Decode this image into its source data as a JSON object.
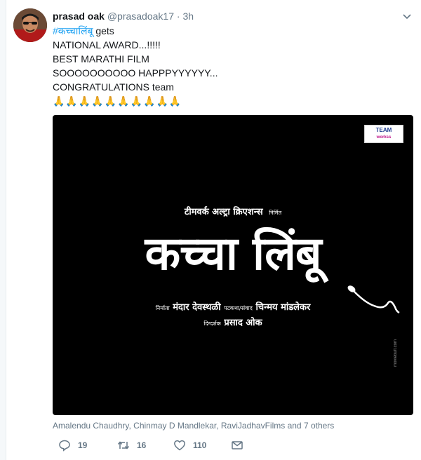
{
  "tweet": {
    "name": "prasad oak",
    "handle": "@prasadoak17",
    "separator": "·",
    "time": "3h",
    "hashtag": "#कच्चालिंबू",
    "lines": [
      "gets",
      "NATIONAL AWARD...!!!!!",
      "BEST MARATHI FILM",
      "SOOOOOOOOOO HAPPPYYYYYY...",
      "CONGRATULATIONS team"
    ],
    "emoji_row": "🙏🙏🙏🙏🙏🙏🙏🙏🙏🙏",
    "avatar_icon": "user-avatar-photo",
    "caret_icon": "chevron-down-icon"
  },
  "poster": {
    "logo_line1": "TEAM",
    "logo_line2": "workss",
    "presents_main": "टीमवर्क अल्ट्रा क्रिएशन्स",
    "presents_small": "निर्मित",
    "title": "कच्चा लिंबू",
    "producer_label": "निर्माता",
    "producer_name": "मंदार देवस्थळी",
    "writer_label": "पटकथा/संवाद",
    "writer_name": "चिन्मय मांडलेकर",
    "director_label": "दिग्दर्शक",
    "director_name": "प्रसाद ओक",
    "side_text": "moviebuff.com"
  },
  "tagged": "Amalendu Chaudhry, Chinmay D Mandlekar, RaviJadhavFilms and 7 others",
  "actions": {
    "reply_count": "19",
    "retweet_count": "16",
    "like_count": "110"
  },
  "colors": {
    "link": "#1da1f2",
    "muted": "#657786",
    "poster_bg": "#000000"
  }
}
